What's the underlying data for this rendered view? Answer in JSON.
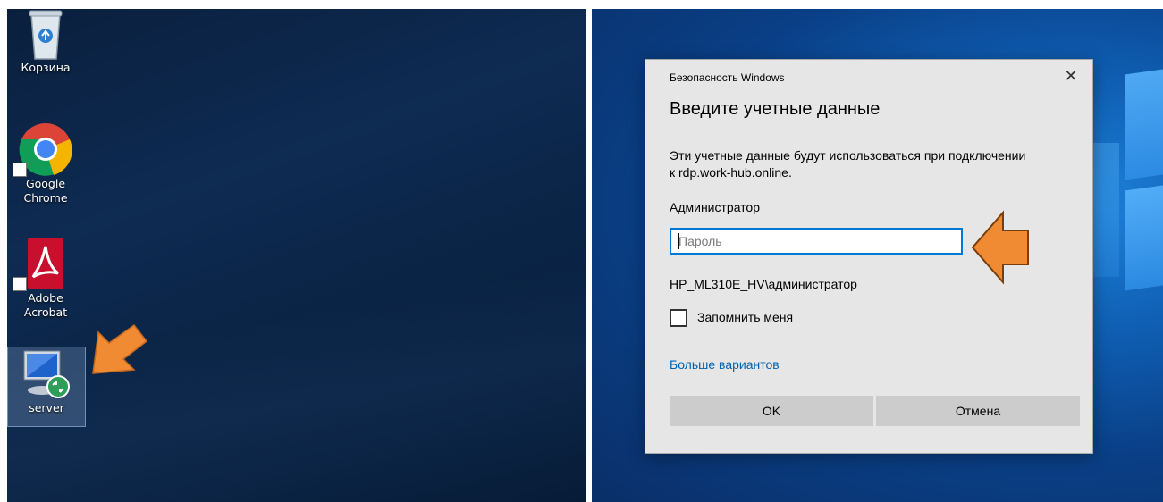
{
  "desktop": {
    "icons": [
      {
        "label": "Корзина"
      },
      {
        "label": "Google\nChrome"
      },
      {
        "label": "Adobe\nAcrobat"
      },
      {
        "label": "server"
      }
    ]
  },
  "dialog": {
    "window_title": "Безопасность Windows",
    "close_symbol": "✕",
    "heading": "Введите учетные данные",
    "message_line1": "Эти учетные данные будут использоваться при подключении",
    "message_line2": "к rdp.work-hub.online.",
    "username": "Администратор",
    "password_placeholder": "Пароль",
    "password_value": "",
    "account": "HP_ML310E_HV\\администратор",
    "remember_label": "Запомнить меня",
    "remember_checked": false,
    "more_options": "Больше вариантов",
    "ok_label": "OK",
    "cancel_label": "Отмена"
  },
  "colors": {
    "accent": "#0078d7",
    "link": "#0063b1",
    "arrow_fill": "#f08a33",
    "arrow_stroke": "#7a3d0c"
  }
}
